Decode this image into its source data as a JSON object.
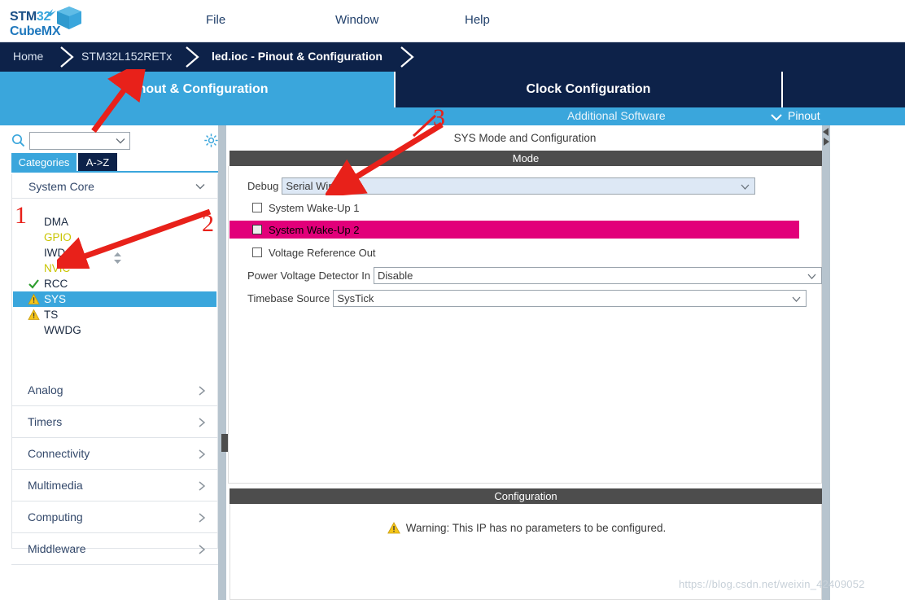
{
  "app": {
    "logo_line1_a": "STM",
    "logo_line1_b": "32",
    "logo_line2": "CubeMX"
  },
  "menu": {
    "items": [
      {
        "label": "File"
      },
      {
        "label": "Window"
      },
      {
        "label": "Help"
      }
    ]
  },
  "breadcrumb": {
    "items": [
      {
        "label": "Home"
      },
      {
        "label": "STM32L152RETx"
      },
      {
        "label": "led.ioc - Pinout & Configuration"
      }
    ]
  },
  "tabs": {
    "pinout": "Pinout & Configuration",
    "clock": "Clock Configuration",
    "blank": ""
  },
  "subbar": {
    "additional_software": "Additional Software",
    "pinout": "Pinout"
  },
  "sidebar": {
    "search": {
      "value": "",
      "placeholder": ""
    },
    "view_tabs": [
      {
        "label": "Categories",
        "active": true
      },
      {
        "label": "A->Z",
        "active": false
      }
    ],
    "group": {
      "label": "System Core"
    },
    "peripherals": [
      {
        "label": "DMA",
        "icon": "none",
        "state": "normal"
      },
      {
        "label": "GPIO",
        "icon": "none",
        "state": "configured"
      },
      {
        "label": "IWDG",
        "icon": "none",
        "state": "normal"
      },
      {
        "label": "NVIC",
        "icon": "none",
        "state": "configured"
      },
      {
        "label": "RCC",
        "icon": "check-icon",
        "state": "normal"
      },
      {
        "label": "SYS",
        "icon": "warning-icon",
        "state": "selected"
      },
      {
        "label": "TS",
        "icon": "warning-icon",
        "state": "normal"
      },
      {
        "label": "WWDG",
        "icon": "none",
        "state": "normal"
      }
    ],
    "categories": [
      {
        "label": "Analog"
      },
      {
        "label": "Timers"
      },
      {
        "label": "Connectivity"
      },
      {
        "label": "Multimedia"
      },
      {
        "label": "Computing"
      },
      {
        "label": "Middleware"
      }
    ]
  },
  "main": {
    "panel_title": "SYS Mode and Configuration",
    "mode_band": "Mode",
    "config_band": "Configuration",
    "debug": {
      "label": "Debug",
      "value": "Serial Wire"
    },
    "checkboxes": [
      {
        "label": "System Wake-Up 1",
        "checked": false,
        "highlighted": false
      },
      {
        "label": "System Wake-Up 2",
        "checked": false,
        "highlighted": true
      },
      {
        "label": "Voltage Reference Out",
        "checked": false,
        "highlighted": false
      }
    ],
    "pvd": {
      "label": "Power Voltage Detector In",
      "value": "Disable"
    },
    "timebase": {
      "label": "Timebase Source",
      "value": "SysTick"
    },
    "config_warning": "Warning: This IP has no parameters to be configured."
  },
  "annotations": {
    "one": "1",
    "two": "2",
    "three": "3"
  },
  "watermark": {
    "text": "https://blog.csdn.net/weixin_42409052"
  },
  "colors": {
    "accent_blue": "#3aa6dc",
    "navy": "#0d2249",
    "highlight_magenta": "#e2007a",
    "band_gray": "#4d4d4d",
    "warning_yellow": "#f5c518",
    "configured_yellow": "#c9c400",
    "annotation_red": "#e8211a"
  }
}
